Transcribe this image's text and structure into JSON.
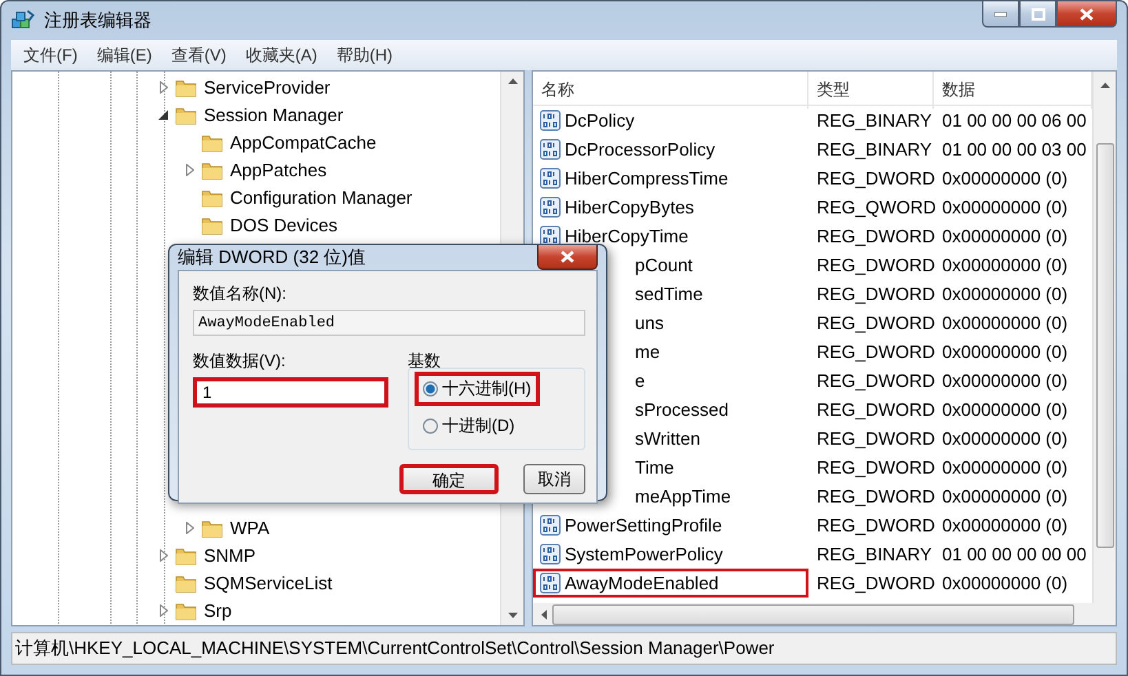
{
  "window": {
    "title": "注册表编辑器"
  },
  "menu": [
    "文件(F)",
    "编辑(E)",
    "查看(V)",
    "收藏夹(A)",
    "帮助(H)"
  ],
  "tree": [
    {
      "label": "ServiceProvider",
      "expanded": false
    },
    {
      "label": "Session Manager",
      "expanded": true,
      "children": [
        {
          "label": "AppCompatCache"
        },
        {
          "label": "AppPatches",
          "expanded": false
        },
        {
          "label": "Configuration Manager"
        },
        {
          "label": "DOS Devices"
        },
        {
          "label": "WPA",
          "expanded": false
        }
      ]
    },
    {
      "label": "SNMP",
      "expanded": false
    },
    {
      "label": "SQMServiceList"
    },
    {
      "label": "Srp",
      "expanded": false
    }
  ],
  "list": {
    "columns": [
      "名称",
      "类型",
      "数据"
    ],
    "rows": [
      {
        "kind": "full",
        "name": "DcPolicy",
        "type": "REG_BINARY",
        "data": "01 00 00 00 06 00",
        "annotated": false
      },
      {
        "kind": "full",
        "name": "DcProcessorPolicy",
        "type": "REG_BINARY",
        "data": "01 00 00 00 03 00",
        "annotated": false
      },
      {
        "kind": "full",
        "name": "HiberCompressTime",
        "type": "REG_DWORD",
        "data": "0x00000000 (0)",
        "annotated": false
      },
      {
        "kind": "full",
        "name": "HiberCopyBytes",
        "type": "REG_QWORD",
        "data": "0x00000000 (0)",
        "annotated": false
      },
      {
        "kind": "full",
        "name": "HiberCopyTime",
        "type": "REG_DWORD",
        "data": "0x00000000 (0)",
        "annotated": false
      },
      {
        "kind": "covered",
        "name": "pCount",
        "type": "REG_DWORD",
        "data": "0x00000000 (0)",
        "annotated": false
      },
      {
        "kind": "covered",
        "name": "sedTime",
        "type": "REG_DWORD",
        "data": "0x00000000 (0)",
        "annotated": false
      },
      {
        "kind": "covered",
        "name": "uns",
        "type": "REG_DWORD",
        "data": "0x00000000 (0)",
        "annotated": false
      },
      {
        "kind": "covered",
        "name": "me",
        "type": "REG_DWORD",
        "data": "0x00000000 (0)",
        "annotated": false
      },
      {
        "kind": "covered",
        "name": "e",
        "type": "REG_DWORD",
        "data": "0x00000000 (0)",
        "annotated": false
      },
      {
        "kind": "covered",
        "name": "sProcessed",
        "type": "REG_DWORD",
        "data": "0x00000000 (0)",
        "annotated": false
      },
      {
        "kind": "covered",
        "name": "sWritten",
        "type": "REG_DWORD",
        "data": "0x00000000 (0)",
        "annotated": false
      },
      {
        "kind": "covered",
        "name": "Time",
        "type": "REG_DWORD",
        "data": "0x00000000 (0)",
        "annotated": false
      },
      {
        "kind": "covered",
        "name": "meAppTime",
        "type": "REG_DWORD",
        "data": "0x00000000 (0)",
        "annotated": false
      },
      {
        "kind": "full",
        "name": "PowerSettingProfile",
        "type": "REG_DWORD",
        "data": "0x00000000 (0)",
        "annotated": false
      },
      {
        "kind": "full",
        "name": "SystemPowerPolicy",
        "type": "REG_BINARY",
        "data": "01 00 00 00 00 00",
        "annotated": false
      },
      {
        "kind": "full",
        "name": "AwayModeEnabled",
        "type": "REG_DWORD",
        "data": "0x00000000 (0)",
        "annotated": true
      }
    ]
  },
  "dialog": {
    "title": "编辑 DWORD (32 位)值",
    "name_label": "数值名称(N):",
    "name_value": "AwayModeEnabled",
    "data_label": "数值数据(V):",
    "data_value": "1",
    "data_annotated": true,
    "base_label": "基数",
    "bases": [
      {
        "label": "十六进制(H)",
        "selected": true,
        "annotated": true
      },
      {
        "label": "十进制(D)",
        "selected": false,
        "annotated": false
      }
    ],
    "buttons": [
      {
        "label": "确定",
        "annotated": true
      },
      {
        "label": "取消",
        "annotated": false
      }
    ]
  },
  "status_bar": "计算机\\HKEY_LOCAL_MACHINE\\SYSTEM\\CurrentControlSet\\Control\\Session Manager\\Power"
}
